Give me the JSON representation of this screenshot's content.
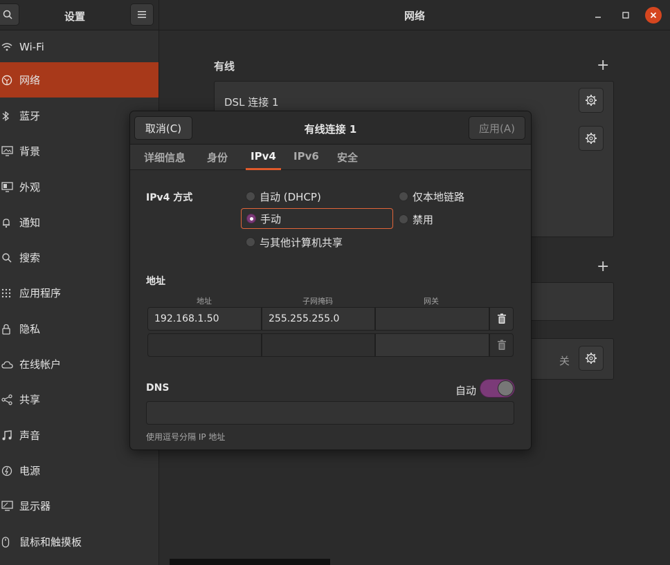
{
  "sidebar": {
    "title": "设置",
    "items": [
      {
        "label": "Wi-Fi",
        "icon": "wifi-icon"
      },
      {
        "label": "网络",
        "icon": "network-icon",
        "active": true
      },
      {
        "label": "蓝牙",
        "icon": "bluetooth-icon"
      },
      {
        "label": "背景",
        "icon": "background-icon"
      },
      {
        "label": "外观",
        "icon": "appearance-icon"
      },
      {
        "label": "通知",
        "icon": "bell-icon"
      },
      {
        "label": "搜索",
        "icon": "search-icon"
      },
      {
        "label": "应用程序",
        "icon": "apps-grid-icon"
      },
      {
        "label": "隐私",
        "icon": "lock-icon"
      },
      {
        "label": "在线帐户",
        "icon": "cloud-icon"
      },
      {
        "label": "共享",
        "icon": "share-icon"
      },
      {
        "label": "声音",
        "icon": "music-note-icon"
      },
      {
        "label": "电源",
        "icon": "power-icon"
      },
      {
        "label": "显示器",
        "icon": "display-icon"
      },
      {
        "label": "鼠标和触摸板",
        "icon": "mouse-icon"
      }
    ]
  },
  "main": {
    "title": "网络",
    "wired_title": "有线",
    "dsl_label": "DSL 连接 1",
    "off_label": "关"
  },
  "dialog": {
    "title": "有线连接 1",
    "cancel_label": "取消(C)",
    "apply_label": "应用(A)",
    "tabs": [
      "详细信息",
      "身份",
      "IPv4",
      "IPv6",
      "安全"
    ],
    "active_tab": "IPv4",
    "ipv4_method_label": "IPv4 方式",
    "methods": {
      "auto": "自动 (DHCP)",
      "link_local": "仅本地链路",
      "manual": "手动",
      "disabled": "禁用",
      "shared": "与其他计算机共享"
    },
    "selected_method": "手动",
    "address_section": "地址",
    "columns": [
      "地址",
      "子网掩码",
      "网关"
    ],
    "rows": [
      {
        "address": "192.168.1.50",
        "netmask": "255.255.255.0",
        "gateway": ""
      },
      {
        "address": "",
        "netmask": "",
        "gateway": ""
      }
    ],
    "dns_label": "DNS",
    "dns_auto_label": "自动",
    "dns_auto_on": true,
    "dns_value": "",
    "dns_hint": "使用逗号分隔 IP 地址"
  },
  "colors": {
    "accent": "#a8391a",
    "toggle_on": "#7b3a78",
    "focus": "#e2653a",
    "close": "#d5461f"
  }
}
